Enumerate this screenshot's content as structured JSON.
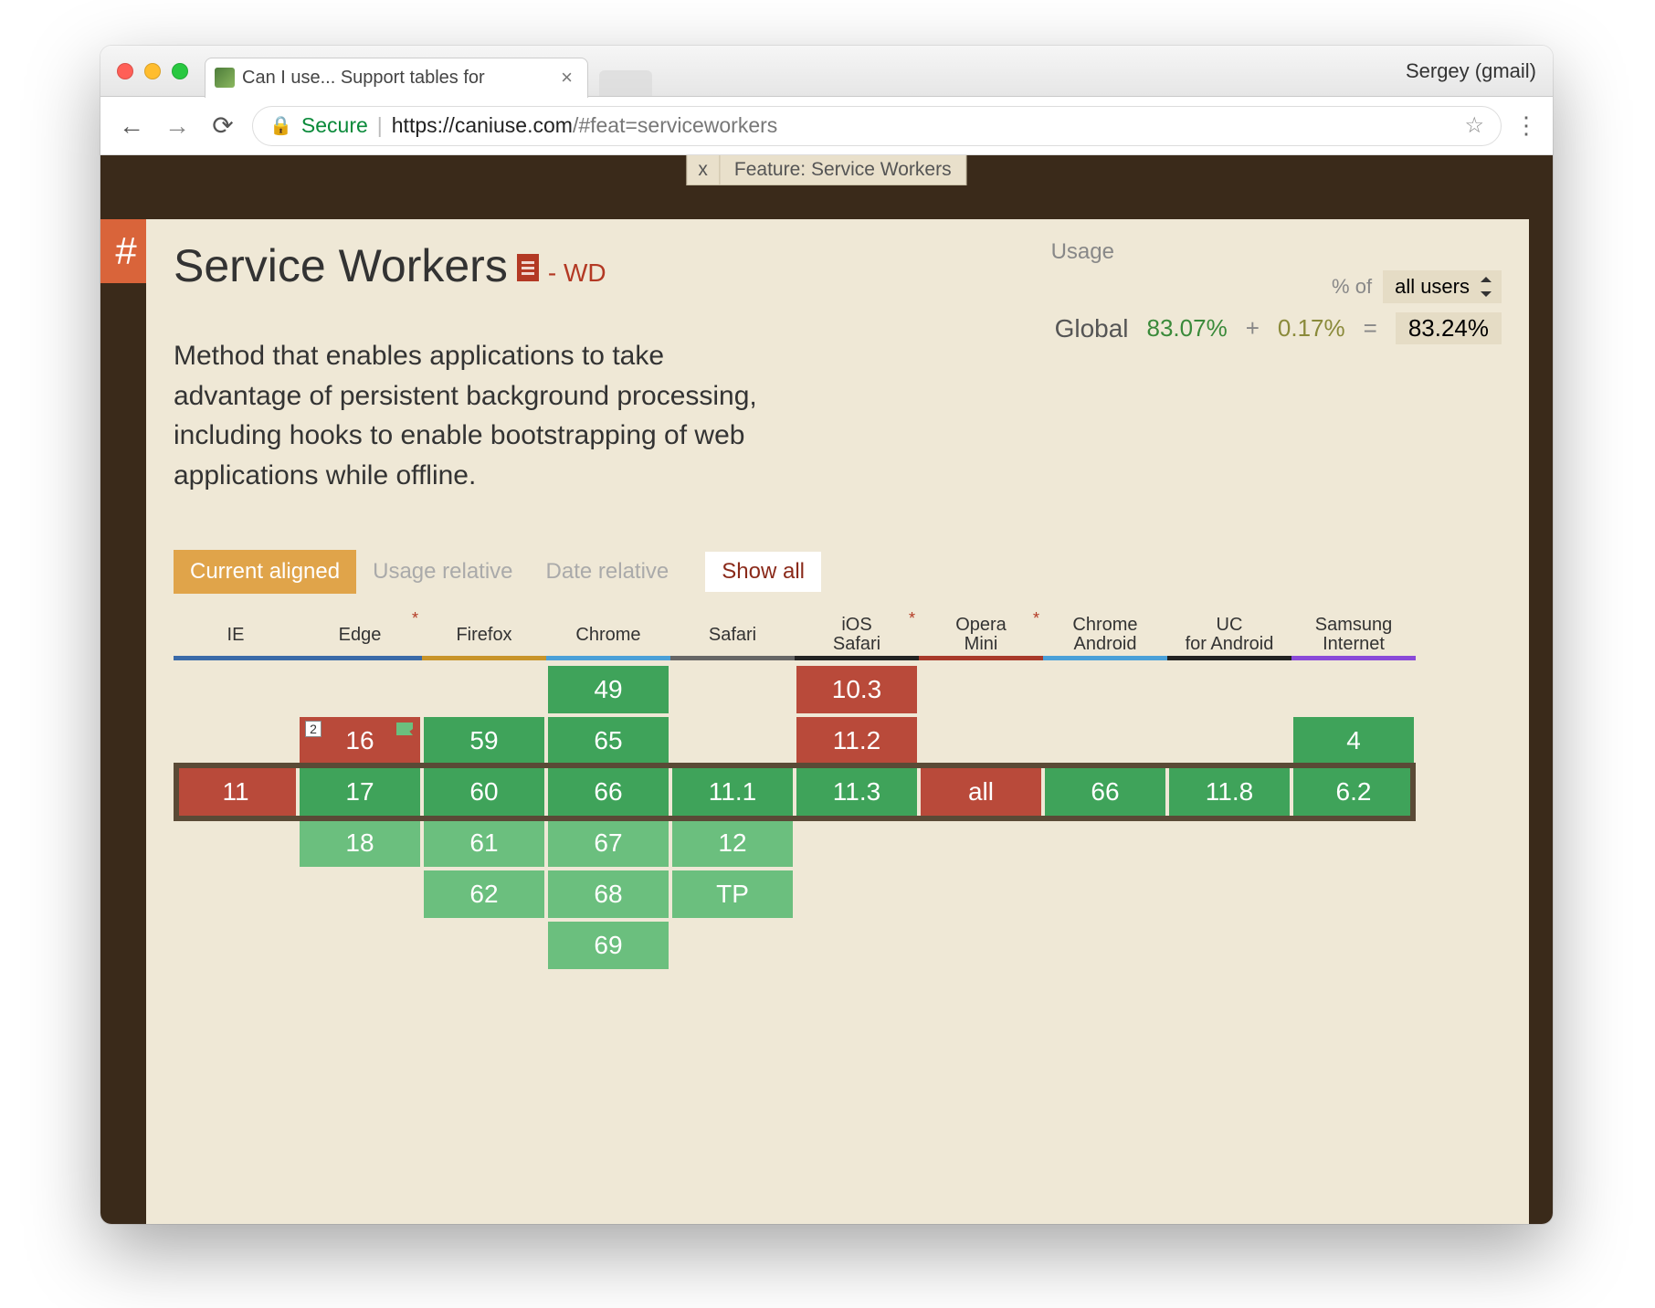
{
  "window": {
    "tab_title": "Can I use... Support tables for",
    "profile": "Sergey (gmail)"
  },
  "address": {
    "secure_label": "Secure",
    "scheme": "https",
    "host": "caniuse.com",
    "path": "/#feat=serviceworkers"
  },
  "feature_pill": {
    "close": "x",
    "label": "Feature: Service Workers"
  },
  "hash": "#",
  "feature": {
    "title": "Service Workers",
    "spec_status": "WD",
    "description": "Method that enables applications to take advantage of persistent background processing, including hooks to enable bootstrapping of web applications while offline."
  },
  "usage": {
    "label": "Usage",
    "pct_of": "% of",
    "select_value": "all users",
    "global_label": "Global",
    "supported": "83.07%",
    "plus": "+",
    "partial": "0.17%",
    "equals": "=",
    "total": "83.24%"
  },
  "view_tabs": {
    "current": "Current aligned",
    "usage": "Usage relative",
    "date": "Date relative",
    "showall": "Show all"
  },
  "browsers": [
    {
      "key": "ie",
      "name": "IE",
      "ast": false
    },
    {
      "key": "edge",
      "name": "Edge",
      "ast": true
    },
    {
      "key": "firefox",
      "name": "Firefox",
      "ast": false
    },
    {
      "key": "chrome",
      "name": "Chrome",
      "ast": false
    },
    {
      "key": "safari",
      "name": "Safari",
      "ast": false
    },
    {
      "key": "ios",
      "name": "iOS Safari",
      "ast": true
    },
    {
      "key": "opera",
      "name": "Opera Mini",
      "ast": true
    },
    {
      "key": "cand",
      "name": "Chrome Android",
      "ast": false
    },
    {
      "key": "uc",
      "name": "UC for Android",
      "ast": false
    },
    {
      "key": "samsung",
      "name": "Samsung Internet",
      "ast": false
    }
  ],
  "grid": {
    "current_row_index": 2,
    "rows": 7,
    "cells": {
      "ie": [
        null,
        null,
        {
          "v": "11",
          "c": "red"
        },
        null,
        null,
        null,
        null
      ],
      "edge": [
        null,
        {
          "v": "16",
          "c": "red",
          "note": "2",
          "flag": true
        },
        {
          "v": "17",
          "c": "green"
        },
        {
          "v": "18",
          "c": "lgreen"
        },
        null,
        null,
        null
      ],
      "firefox": [
        null,
        {
          "v": "59",
          "c": "green"
        },
        {
          "v": "60",
          "c": "green"
        },
        {
          "v": "61",
          "c": "lgreen"
        },
        {
          "v": "62",
          "c": "lgreen"
        },
        null,
        null
      ],
      "chrome": [
        {
          "v": "49",
          "c": "green"
        },
        {
          "v": "65",
          "c": "green"
        },
        {
          "v": "66",
          "c": "green"
        },
        {
          "v": "67",
          "c": "lgreen"
        },
        {
          "v": "68",
          "c": "lgreen"
        },
        {
          "v": "69",
          "c": "lgreen"
        },
        null
      ],
      "safari": [
        null,
        null,
        {
          "v": "11.1",
          "c": "green"
        },
        {
          "v": "12",
          "c": "lgreen"
        },
        {
          "v": "TP",
          "c": "lgreen"
        },
        null,
        null
      ],
      "ios": [
        {
          "v": "10.3",
          "c": "red"
        },
        {
          "v": "11.2",
          "c": "red"
        },
        {
          "v": "11.3",
          "c": "green"
        },
        null,
        null,
        null,
        null
      ],
      "opera": [
        null,
        null,
        {
          "v": "all",
          "c": "red"
        },
        null,
        null,
        null,
        null
      ],
      "cand": [
        null,
        null,
        {
          "v": "66",
          "c": "green"
        },
        null,
        null,
        null,
        null
      ],
      "uc": [
        null,
        null,
        {
          "v": "11.8",
          "c": "green"
        },
        null,
        null,
        null,
        null
      ],
      "samsung": [
        null,
        {
          "v": "4",
          "c": "green"
        },
        {
          "v": "6.2",
          "c": "green"
        },
        null,
        null,
        null,
        null
      ]
    }
  }
}
